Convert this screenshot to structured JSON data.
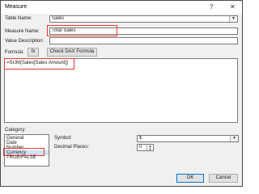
{
  "window": {
    "title": "Measure",
    "help_icon": "?",
    "close_icon": "✕"
  },
  "form": {
    "table_name_label": "Table Name:",
    "table_name_value": "Sales",
    "measure_name_label": "Measure Name:",
    "measure_name_value": "Total Sales",
    "value_description_label": "Value Description:",
    "value_description_value": "",
    "formula_label": "Formula:",
    "fx_label": "fx",
    "check_dax_label": "Check DAX Formula",
    "formula_text": "=SUM(Sales[Sales Amount])"
  },
  "category": {
    "label": "Category:",
    "items": [
      "General",
      "Date",
      "Number",
      "Currency",
      "TRUE/FALSE"
    ],
    "selected": "Currency"
  },
  "format": {
    "symbol_label": "Symbol:",
    "symbol_value": "$",
    "decimal_label": "Decimal Places:",
    "decimal_value": "0"
  },
  "buttons": {
    "ok": "OK",
    "cancel": "Cancel"
  }
}
